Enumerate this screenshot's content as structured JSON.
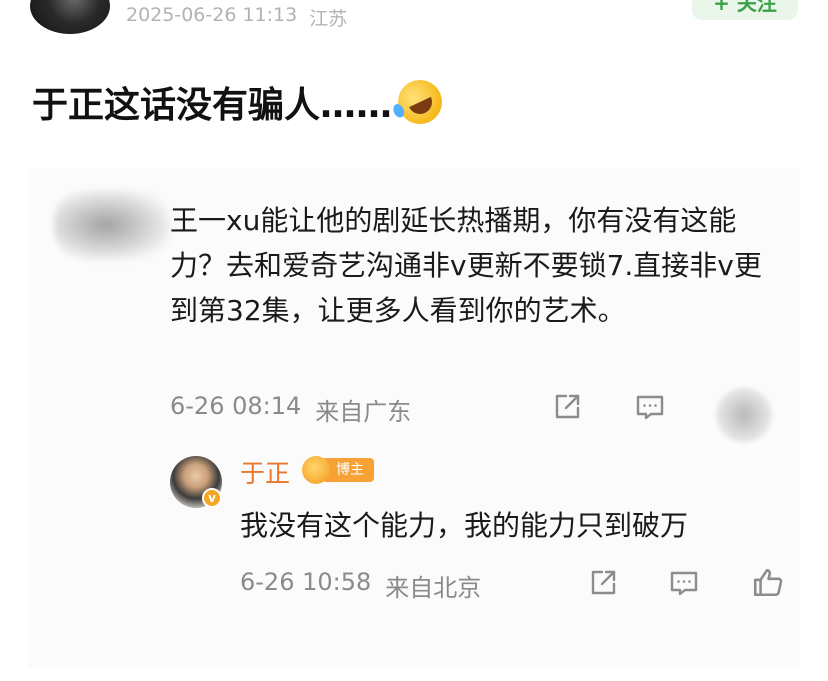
{
  "post": {
    "timestamp": "2025-06-26 11:13",
    "location": "江苏",
    "follow_label": "+ 关注",
    "text": "于正这话没有骗人……",
    "emoji": "rolling-on-floor-laughing"
  },
  "comment": {
    "text": "王一xu能让他的剧延长热播期，你有没有这能力？去和爱奇艺沟通非v更新不要锁7.直接非v更到第32集，让更多人看到你的艺术。",
    "time": "6-26 08:14",
    "location": "来自广东"
  },
  "reply": {
    "author": "于正",
    "badge": "博主",
    "verified_mark": "v",
    "text": "我没有这个能力，我的能力只到破万",
    "time": "6-26 10:58",
    "location": "来自北京"
  },
  "colors": {
    "accent_orange": "#e8762c",
    "follow_green": "#3aa14a",
    "badge_gold": "#f7a234"
  },
  "icons": [
    "share-icon",
    "comment-icon",
    "like-icon"
  ]
}
